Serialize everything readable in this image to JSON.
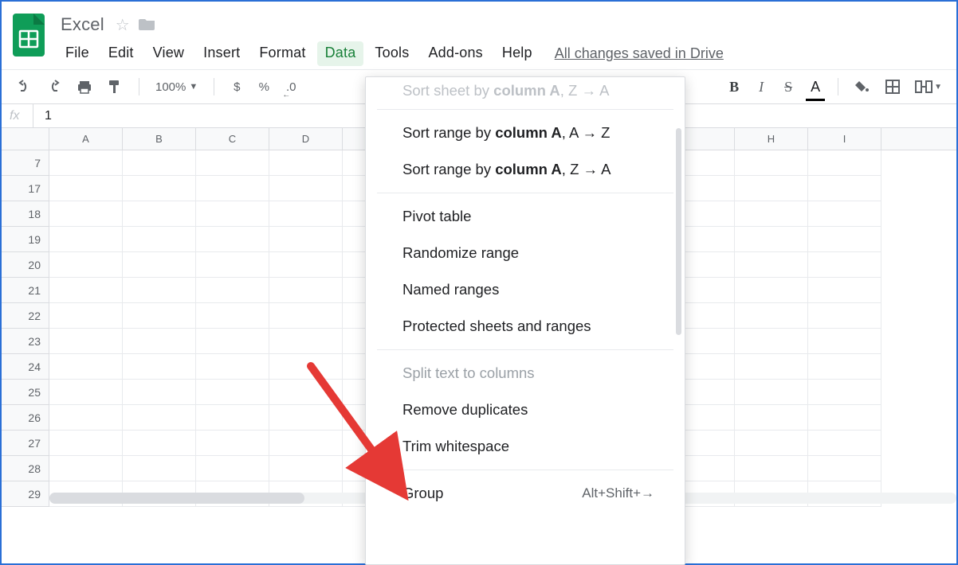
{
  "doc": {
    "title": "Excel"
  },
  "menu": {
    "file": "File",
    "edit": "Edit",
    "view": "View",
    "insert": "Insert",
    "format": "Format",
    "data": "Data",
    "tools": "Tools",
    "addons": "Add-ons",
    "help": "Help",
    "saved": "All changes saved in Drive"
  },
  "toolbar": {
    "zoom": "100%",
    "currency": "$",
    "percent": "%",
    "dec0": ".0"
  },
  "formulabar": {
    "fx": "fx",
    "value": "1"
  },
  "columns": [
    "A",
    "B",
    "C",
    "D",
    "",
    "",
    "H",
    "I"
  ],
  "rows": [
    "7",
    "17",
    "18",
    "19",
    "20",
    "21",
    "22",
    "23",
    "24",
    "25",
    "26",
    "27",
    "28",
    "29"
  ],
  "data_menu": {
    "sort_sheet_za_cut": {
      "pre": "Sort sheet by ",
      "col": "column A",
      "suf": ", Z → A"
    },
    "sort_range_az": {
      "pre": "Sort range by ",
      "col": "column A",
      "suf": ", A → Z"
    },
    "sort_range_za": {
      "pre": "Sort range by ",
      "col": "column A",
      "suf": ", Z → A"
    },
    "pivot": "Pivot table",
    "randomize": "Randomize range",
    "named": "Named ranges",
    "protected": "Protected sheets and ranges",
    "split": "Split text to columns",
    "remove_dup": "Remove duplicates",
    "trim": "Trim whitespace",
    "group": "Group",
    "group_shortcut": "Alt+Shift+→"
  }
}
